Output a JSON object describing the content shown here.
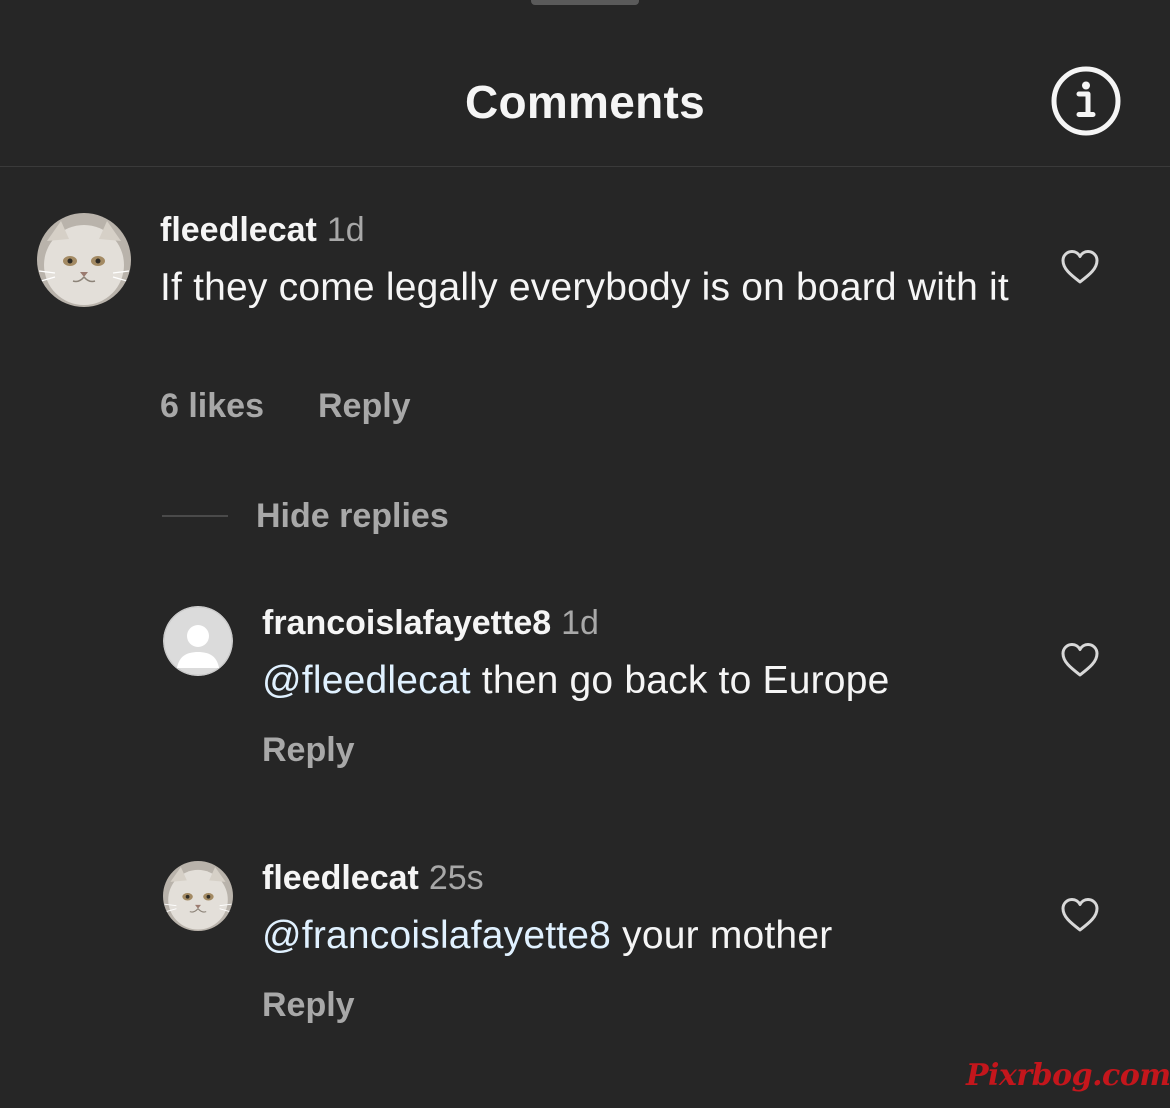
{
  "header": {
    "title": "Comments"
  },
  "comments": [
    {
      "username": "fleedlecat",
      "time": "1d",
      "text": "If they come legally everybody is on board with it",
      "likes": "6 likes",
      "reply_label": "Reply"
    }
  ],
  "replies_toggle": {
    "label": "Hide replies"
  },
  "replies": [
    {
      "username": "francoislafayette8",
      "time": "1d",
      "mention": "@fleedlecat",
      "text": " then go back to Europe",
      "reply_label": "Reply"
    },
    {
      "username": "fleedlecat",
      "time": "25s",
      "mention": "@francoislafayette8",
      "text": " your mother",
      "reply_label": "Reply"
    }
  ],
  "watermark": "Pixrbog.com",
  "colors": {
    "background": "#262626",
    "primary_text": "#f5f5f5",
    "secondary_text": "#a8a8a8",
    "mention": "#e0f1ff",
    "divider": "#3a3a3a"
  },
  "icons": {
    "info": "info-icon",
    "like": "heart-outline-icon"
  }
}
